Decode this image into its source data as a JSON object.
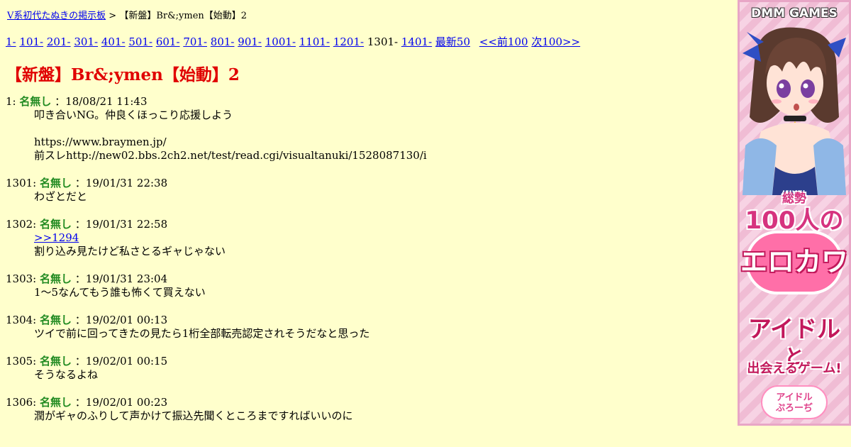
{
  "breadcrumb": {
    "board_link": "V系初代たぬきの掲示板",
    "separator": ">",
    "current": "【新盤】Br&;ymen【始動】2"
  },
  "pager": {
    "pages": [
      {
        "label": "1-",
        "current": false
      },
      {
        "label": "101-",
        "current": false
      },
      {
        "label": "201-",
        "current": false
      },
      {
        "label": "301-",
        "current": false
      },
      {
        "label": "401-",
        "current": false
      },
      {
        "label": "501-",
        "current": false
      },
      {
        "label": "601-",
        "current": false
      },
      {
        "label": "701-",
        "current": false
      },
      {
        "label": "801-",
        "current": false
      },
      {
        "label": "901-",
        "current": false
      },
      {
        "label": "1001-",
        "current": false
      },
      {
        "label": "1101-",
        "current": false
      },
      {
        "label": "1201-",
        "current": false
      },
      {
        "label": "1301-",
        "current": true
      },
      {
        "label": "1401-",
        "current": false
      }
    ],
    "latest50": "最新50",
    "prev100": "<<前100",
    "next100": "次100>>"
  },
  "thread_title": "【新盤】Br&;ymen【始動】2",
  "posts": [
    {
      "num": "1:",
      "name": "名無し",
      "date": "：18/08/21 11:43",
      "lines": [
        "叩き合いNG。仲良くほっこり応援しよう",
        "",
        "https://www.braymen.jp/",
        "前スレhttp://new02.bbs.2ch2.net/test/read.cgi/visualtanuki/1528087130/i"
      ]
    },
    {
      "num": "1301:",
      "name": "名無し",
      "date": "：19/01/31 22:38",
      "lines": [
        "わざとだと"
      ]
    },
    {
      "num": "1302:",
      "name": "名無し",
      "date": "：19/01/31 22:58",
      "anchor": ">>1294",
      "lines": [
        "割り込み見たけど私さとるギャじゃない"
      ]
    },
    {
      "num": "1303:",
      "name": "名無し",
      "date": "：19/01/31 23:04",
      "lines": [
        "1～5なんてもう誰も怖くて買えない"
      ]
    },
    {
      "num": "1304:",
      "name": "名無し",
      "date": "：19/02/01 00:13",
      "lines": [
        "ツイで前に回ってきたの見たら1桁全部転売認定されそうだなと思った"
      ]
    },
    {
      "num": "1305:",
      "name": "名無し",
      "date": "：19/02/01 00:15",
      "lines": [
        "そうなるよね"
      ]
    },
    {
      "num": "1306:",
      "name": "名無し",
      "date": "：19/02/01 00:23",
      "lines": [
        "潤がギャのふりして声かけて振込先聞くところまですればいいのに"
      ]
    }
  ],
  "ad": {
    "brand": "DMM GAMES",
    "line1": "総勢",
    "line2": "100人の",
    "line3": "エロカワ",
    "line4": "アイドル",
    "line5": "と",
    "line6": "出会えるゲーム!",
    "logo": "アイドル\nぷろーぢ"
  },
  "colors": {
    "background": "#ffffcc",
    "title": "#e00000",
    "name": "#228b22",
    "link": "#0000ee"
  }
}
